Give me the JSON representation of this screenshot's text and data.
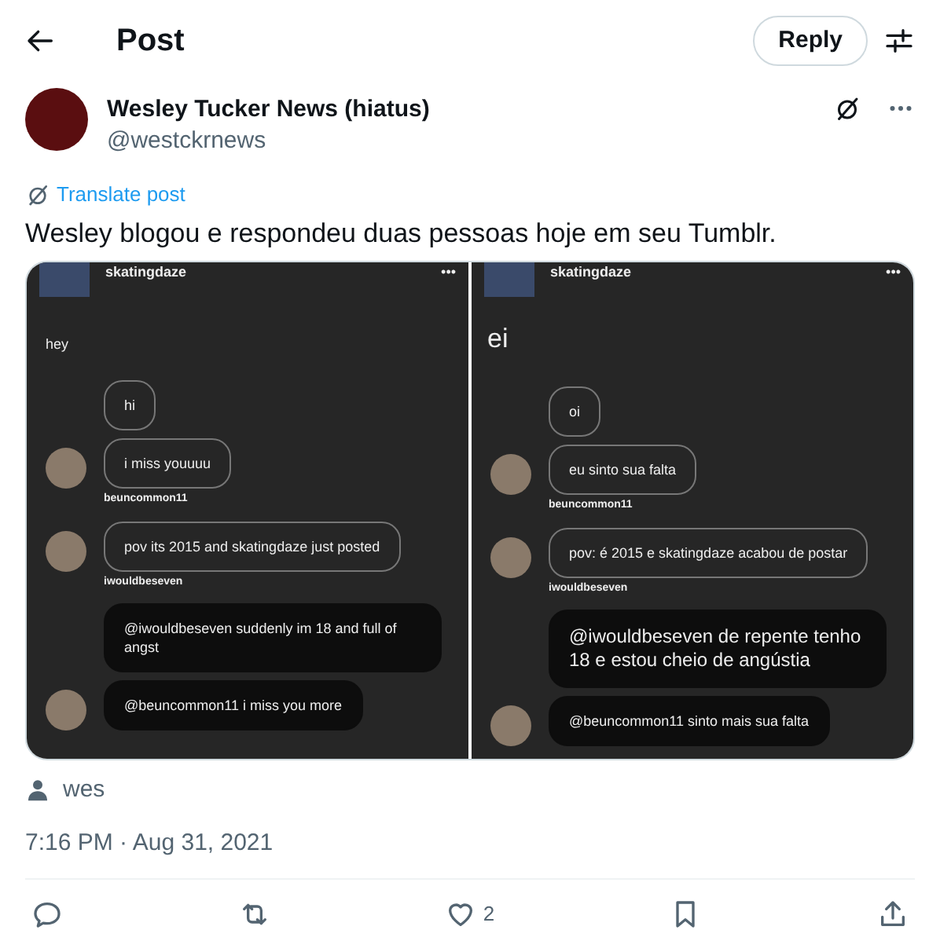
{
  "header": {
    "title": "Post",
    "reply_button": "Reply"
  },
  "author": {
    "name": "Wesley Tucker News (hiatus)",
    "handle": "@westckrnews"
  },
  "translate_link": "Translate post",
  "text": "Wesley blogou e respondeu duas pessoas hoje em seu Tumblr.",
  "images": [
    {
      "blog": "skatingdaze",
      "menu": "•••",
      "post_text": "hey",
      "post_text_large": false,
      "messages": [
        {
          "kind": "outline",
          "text": "hi",
          "large": false,
          "avatar": false
        },
        {
          "kind": "outline",
          "text": "i miss youuuu",
          "large": false,
          "avatar": true,
          "user": "beuncommon11"
        },
        {
          "kind": "outline",
          "text": "pov its 2015 and skatingdaze just posted",
          "large": false,
          "avatar": true,
          "user": "iwouldbeseven"
        },
        {
          "kind": "filled",
          "text": "@iwouldbeseven suddenly im 18 and full of angst",
          "large": false,
          "avatar": false
        },
        {
          "kind": "filled",
          "text": "@beuncommon11 i miss you more",
          "large": false,
          "avatar": true
        }
      ]
    },
    {
      "blog": "skatingdaze",
      "menu": "•••",
      "post_text": "ei",
      "post_text_large": true,
      "messages": [
        {
          "kind": "outline",
          "text": "oi",
          "large": false,
          "avatar": false
        },
        {
          "kind": "outline",
          "text": "eu sinto sua falta",
          "large": false,
          "avatar": true,
          "user": "beuncommon11"
        },
        {
          "kind": "outline",
          "text": "pov: é 2015 e skatingdaze acabou de postar",
          "large": false,
          "avatar": true,
          "user": "iwouldbeseven"
        },
        {
          "kind": "filled",
          "text": "@iwouldbeseven de repente tenho 18 e estou cheio de angústia",
          "large": true,
          "avatar": false
        },
        {
          "kind": "filled",
          "text": "@beuncommon11 sinto mais sua falta",
          "large": false,
          "avatar": true
        }
      ]
    }
  ],
  "tagged": "wes",
  "timestamp": "7:16 PM · Aug 31, 2021",
  "actions": {
    "likes": "2"
  }
}
